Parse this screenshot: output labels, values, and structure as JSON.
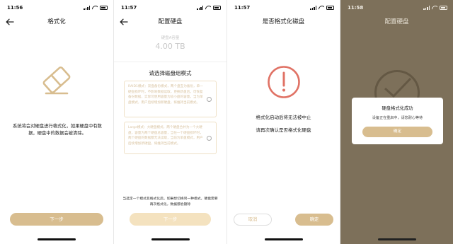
{
  "colors": {
    "accent": "#d8bd8f",
    "accent_disabled": "#f4e2bf",
    "alert_red": "#e07265",
    "overlay_bg": "#7d705a"
  },
  "screens": [
    {
      "status_time": "11:56",
      "title": "格式化",
      "icon": "eraser-icon",
      "description": "系统将会对硬盘进行格式化，如果硬盘中有数据，硬盘中的数据会被清除。",
      "primary_button": "下一步"
    },
    {
      "status_time": "11:57",
      "title": "配置硬盘",
      "capacity_label": "硬盘A容量",
      "capacity_value": "4.00 TB",
      "choose_label": "请选择磁盘组模式",
      "options": [
        {
          "text": "RAID1模式：双盘备份模式，两个盘互为备份，单一硬盘损坏时，不影响数据读取，更换新盘后，可恢复备份数据，实际可使用容量为较小盘的容量，当为单盘模式，用户后续增加新硬盘，将维持当前模式。",
          "selected": false
        },
        {
          "text": "Large模式：大硬盘模式，两个硬盘合并为一个大硬盘，容量为两个硬盘总容量，当任一个硬盘损坏时，两个硬盘的数据都无法读取，当前为单盘模式，用户后续增加新硬盘，将维持当前模式。",
          "selected": false
        }
      ],
      "warning": "当选定一个模式且格式化后，如果想切换另一种模式，硬盘需要再次格式化，数据都会删除",
      "primary_button": "下一步"
    },
    {
      "status_time": "11:57",
      "title": "是否格式化磁盘",
      "icon": "alert-icon",
      "line1": "格式化启动后将无法被中止",
      "line2": "请再次确认是否格式化硬盘",
      "cancel_button": "取消",
      "confirm_button": "确定"
    },
    {
      "status_time": "11:58",
      "title": "配置硬盘",
      "dialog": {
        "title": "硬盘格式化成功",
        "message": "设备正在重启中，请您耐心等待",
        "button": "确定"
      }
    }
  ]
}
